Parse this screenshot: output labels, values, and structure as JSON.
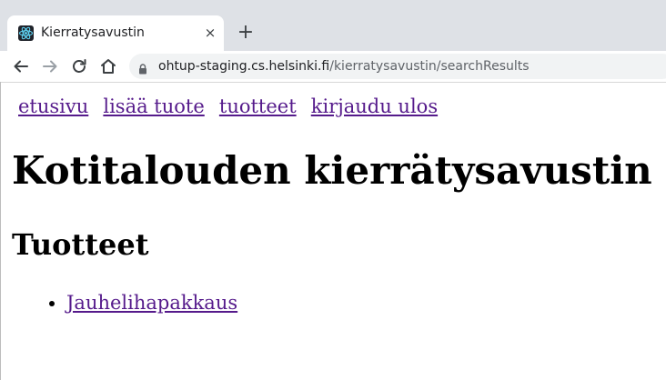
{
  "browser": {
    "tab": {
      "title": "Kierratysavustin",
      "favicon": "react-icon",
      "close_glyph": "×"
    },
    "new_tab_glyph": "+",
    "url": {
      "host": "ohtup-staging.cs.helsinki.fi",
      "path": "/kierratysavustin/searchResults"
    }
  },
  "navbar": {
    "items": [
      {
        "label": "etusivu"
      },
      {
        "label": "lisää tuote"
      },
      {
        "label": "tuotteet"
      },
      {
        "label": "kirjaudu ulos"
      }
    ]
  },
  "page": {
    "title": "Kotitalouden kierrätysavustin",
    "section_title": "Tuotteet",
    "products": [
      {
        "label": "Jauhelihapakkaus"
      }
    ]
  },
  "colors": {
    "link": "#551a8b",
    "tabstrip": "#dee1e6",
    "omnibox": "#f1f3f4"
  }
}
